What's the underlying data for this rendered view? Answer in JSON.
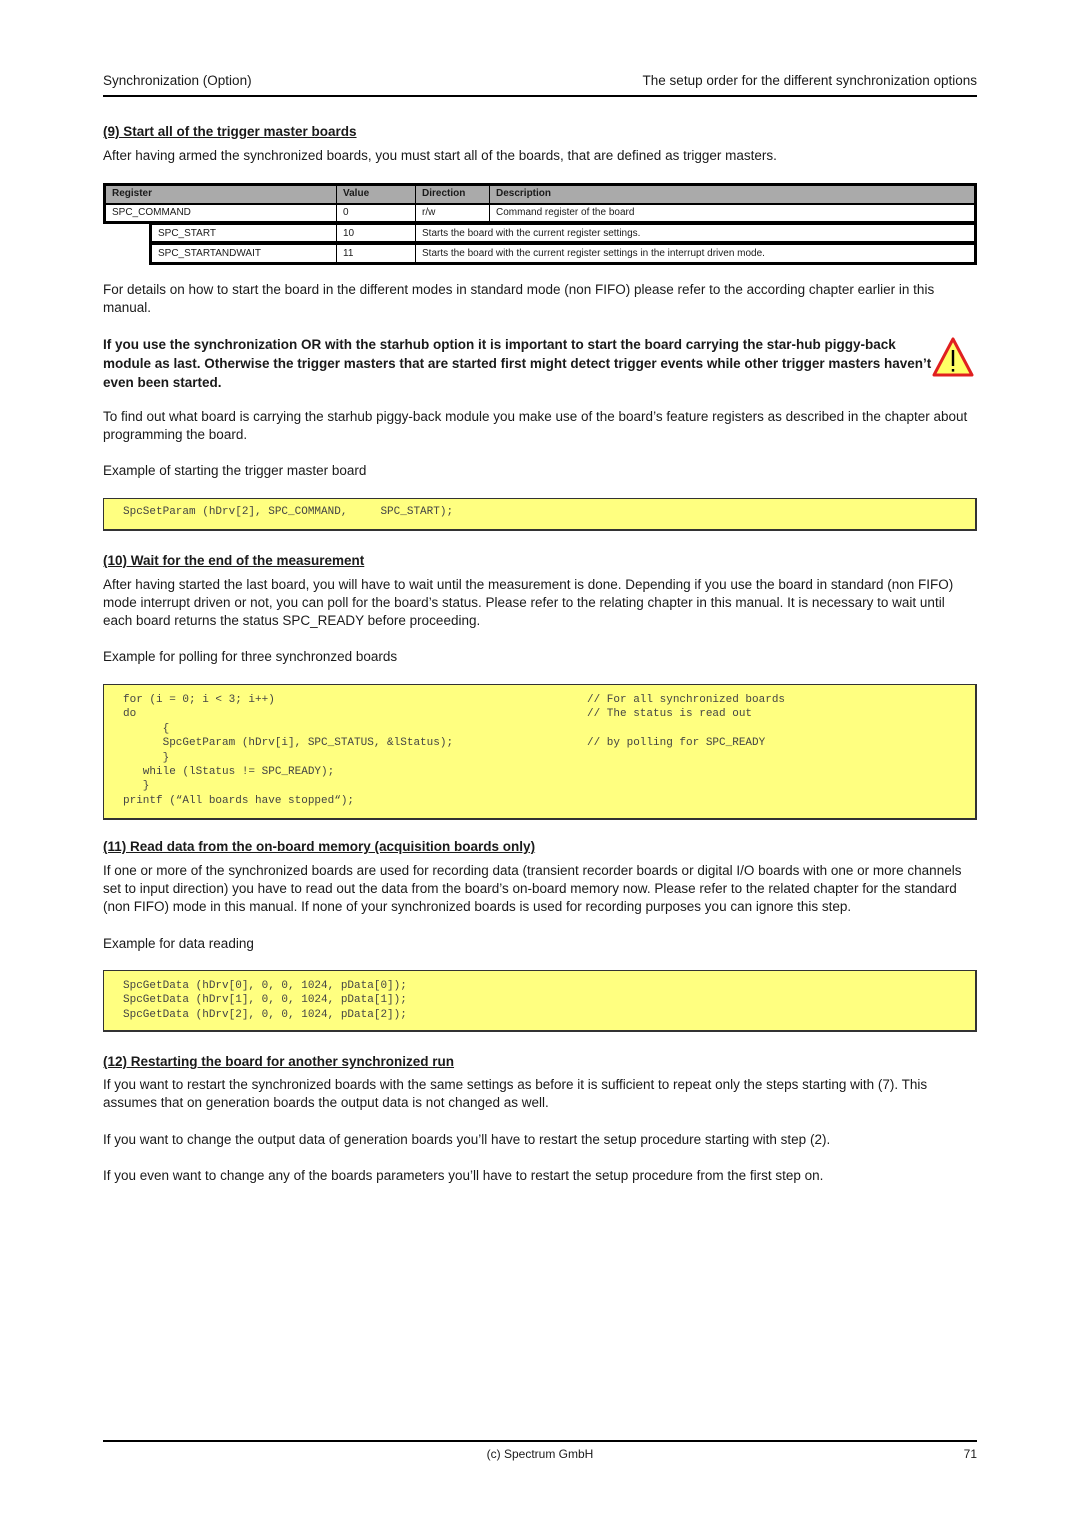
{
  "header": {
    "left": "Synchronization (Option)",
    "right": "The setup order for the different synchronization options"
  },
  "section9": {
    "title": "(9) Start all of the trigger master boards",
    "intro": "After having armed the synchronized boards, you must start all of the boards, that are defined as trigger masters.",
    "table": {
      "headers": [
        "Register",
        "Value",
        "Direction",
        "Description"
      ],
      "main_row": {
        "register": "SPC_COMMAND",
        "value": "0",
        "direction": "r/w",
        "description": "Command register of the board"
      },
      "sub_rows": [
        {
          "register": "SPC_START",
          "value": "10",
          "description": "Starts the board with the current register settings."
        },
        {
          "register": "SPC_STARTANDWAIT",
          "value": "11",
          "description": "Starts the board with the current register settings in the interrupt driven mode."
        }
      ]
    },
    "details": "For details on how to start the board in the different modes in standard mode (non FIFO) please refer to the according chapter earlier in this manual.",
    "warning": "If you use the synchronization OR with the starhub option it is important to start the board carrying the star-hub piggy-back module as last. Otherwise the trigger masters that are started first might detect trigger events while other trigger masters haven’t even been started.",
    "warning_icon": "warning-triangle-icon",
    "find_out": "To find out what board is carrying the starhub piggy-back module you make use of the board’s feature registers as described in the chapter about programming the board.",
    "example_label": "Example of starting the trigger master board",
    "code": [
      {
        "code": "SpcSetParam (hDrv[2], SPC_COMMAND,     SPC_START);",
        "comment": ""
      }
    ]
  },
  "section10": {
    "title": "(10) Wait for the end of the measurement",
    "body": "After having started the last board, you will have to wait until the measurement is done. Depending if you use the board in standard (non FIFO) mode interrupt driven or not, you can poll for the board’s status. Please refer to the relating chapter in this manual. It is necessary to wait until each board returns the status SPC_READY before proceeding.",
    "example_label": "Example for polling for three synchronzed boards",
    "code": [
      {
        "code": "for (i = 0; i < 3; i++)",
        "comment": "// For all synchronized boards"
      },
      {
        "code": "do",
        "comment": "// The status is read out"
      },
      {
        "code": "      {",
        "comment": ""
      },
      {
        "code": "      SpcGetParam (hDrv[i], SPC_STATUS, &lStatus);",
        "comment": "// by polling for SPC_READY"
      },
      {
        "code": "      }",
        "comment": ""
      },
      {
        "code": "   while (lStatus != SPC_READY);",
        "comment": ""
      },
      {
        "code": "   }",
        "comment": ""
      },
      {
        "code": "printf (“All boards have stopped“);",
        "comment": ""
      }
    ]
  },
  "section11": {
    "title": "(11) Read data from the on-board memory (acquisition boards only)",
    "body": "If one or more of the synchronized boards are used for recording data (transient recorder boards or digital I/O boards with one or more channels set to input direction) you have to read out the data from the board’s on-board memory now. Please refer to the related chapter for the standard (non FIFO) mode in this manual. If none of your synchronized boards is used for recording purposes you can ignore this step.",
    "example_label": "Example for data reading",
    "code": [
      {
        "code": "SpcGetData (hDrv[0], 0, 0, 1024, pData[0]);",
        "comment": ""
      },
      {
        "code": "SpcGetData (hDrv[1], 0, 0, 1024, pData[1]);",
        "comment": ""
      },
      {
        "code": "SpcGetData (hDrv[2], 0, 0, 1024, pData[2]);",
        "comment": ""
      }
    ]
  },
  "section12": {
    "title": "(12) Restarting the board for another synchronized run",
    "paragraphs": [
      "If you want to restart the synchronized boards with the same settings as before it is sufficient to repeat only the steps starting with (7). This assumes that on generation boards the output data is not changed as well.",
      "If you want to change the output data of generation boards you’ll have to restart the setup procedure starting with step (2).",
      "If you even want to change any of the boards parameters you’ll have to restart the setup procedure from the first step on."
    ]
  },
  "footer": {
    "copyright": "(c) Spectrum GmbH",
    "page_number": "71"
  }
}
